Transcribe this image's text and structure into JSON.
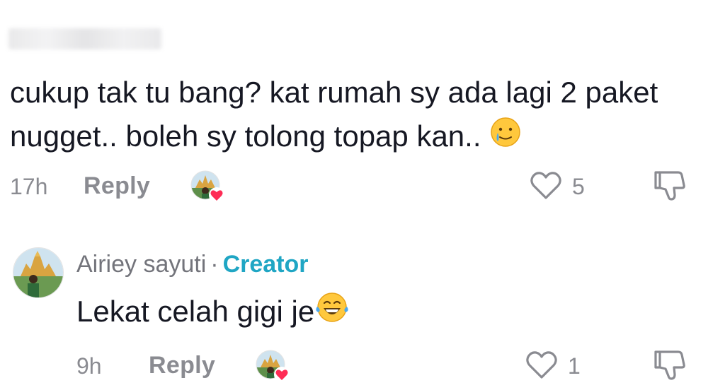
{
  "comment": {
    "text": "cukup tak tu bang? kat rumah sy ada lagi 2 paket nugget.. boleh sy tolong topap kan..",
    "emoji_icon": "crying-smile-icon",
    "time": "17h",
    "reply_label": "Reply",
    "likes": "5",
    "creator_liked": true
  },
  "reply": {
    "author": "Airiey sayuti",
    "separator": "·",
    "badge": "Creator",
    "text": "Lekat celah gigi je",
    "emoji_icon": "laughing-tears-icon",
    "time": "9h",
    "reply_label": "Reply",
    "likes": "1",
    "creator_liked": true
  },
  "colors": {
    "text": "#161823",
    "muted": "#8a8b91",
    "creator_badge": "#20a6c4",
    "heart_badge": "#fe2c55"
  }
}
